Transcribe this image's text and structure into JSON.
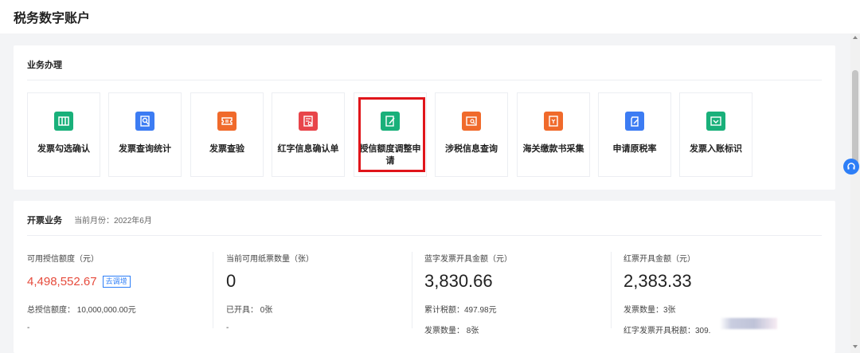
{
  "header": {
    "title": "税务数字账户"
  },
  "business": {
    "title": "业务办理",
    "tiles": [
      {
        "label": "发票勾选确认",
        "icon": "invoice-check-icon",
        "color": "#19b07a"
      },
      {
        "label": "发票查询统计",
        "icon": "invoice-search-icon",
        "color": "#3c7cf3"
      },
      {
        "label": "发票查验",
        "icon": "ticket-verify-icon",
        "color": "#f06a2b"
      },
      {
        "label": "红字信息确认单",
        "icon": "red-letter-form-icon",
        "color": "#e8454a"
      },
      {
        "label": "授信额度调整申请",
        "icon": "credit-adjust-icon",
        "color": "#19b07a"
      },
      {
        "label": "涉税信息查询",
        "icon": "tax-info-search-icon",
        "color": "#f06a2b"
      },
      {
        "label": "海关缴款书采集",
        "icon": "customs-payment-icon",
        "color": "#f06a2b"
      },
      {
        "label": "申请原税率",
        "icon": "tax-rate-apply-icon",
        "color": "#3c7cf3"
      },
      {
        "label": "发票入账标识",
        "icon": "invoice-entry-icon",
        "color": "#19b07a"
      }
    ]
  },
  "issuing": {
    "title": "开票业务",
    "month": "当前月份：2022年6月",
    "columns": [
      {
        "label": "可用授信额度（元）",
        "value": "4,498,552.67",
        "badge": "去调增",
        "sub1": "总授信额度： 10,000,000.00元",
        "sub2": "-"
      },
      {
        "label": "当前可用纸票数量（张）",
        "value": "0",
        "sub1": "已开具： 0张",
        "sub2": "-"
      },
      {
        "label": "蓝字发票开具金额（元）",
        "value": "3,830.66",
        "sub1": "累计税额：497.98元",
        "sub2": "发票数量： 8张"
      },
      {
        "label": "红票开具金额（元）",
        "value": "2,383.33",
        "sub1": "发票数量：3张",
        "sub2": "红字发票开具税额：309."
      }
    ]
  },
  "colors": {
    "accent": "#2d7ef7",
    "credit_value": "#e64b3c",
    "highlight_box": "#e0151b"
  }
}
